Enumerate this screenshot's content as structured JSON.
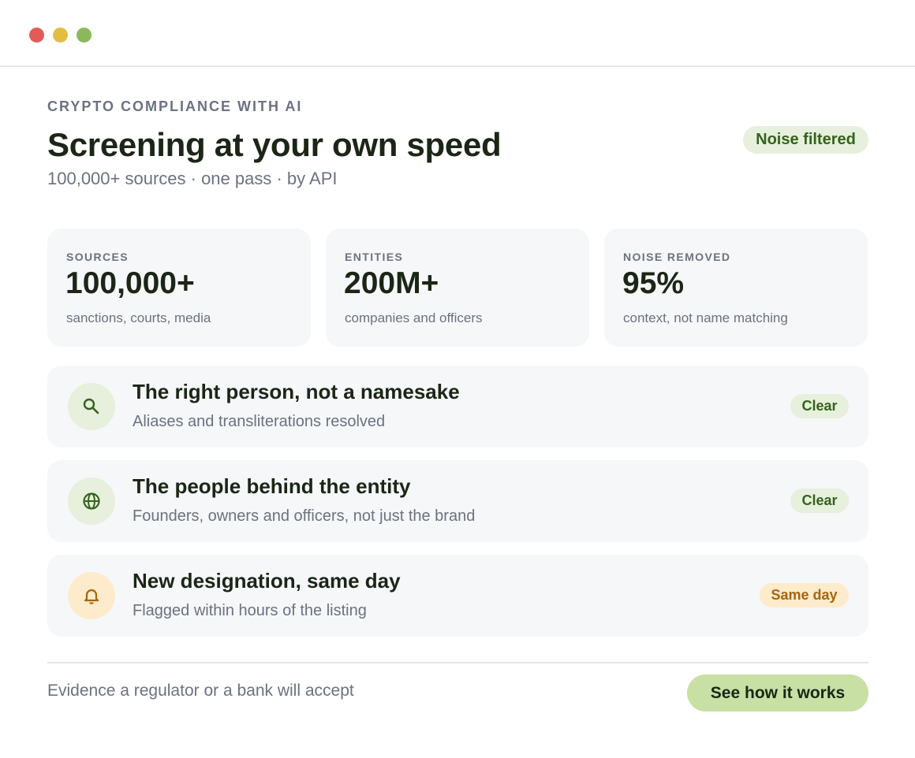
{
  "window": {
    "controls": [
      "close",
      "minimize",
      "maximize"
    ]
  },
  "hero": {
    "eyebrow": "CRYPTO COMPLIANCE WITH AI",
    "title": "Screening at your own speed",
    "subtitle": "100,000+ sources · one pass · by API",
    "status_pill": "Noise filtered"
  },
  "stats": [
    {
      "label": "SOURCES",
      "value": "100,000+",
      "description": "sanctions, courts, media"
    },
    {
      "label": "ENTITIES",
      "value": "200M+",
      "description": "companies and officers"
    },
    {
      "label": "NOISE REMOVED",
      "value": "95%",
      "description": "context, not name matching"
    }
  ],
  "features": [
    {
      "icon": "search-icon",
      "title": "The right person, not a namesake",
      "description": "Aliases and transliterations resolved",
      "badge": "Clear",
      "badge_color": "#35631c"
    },
    {
      "icon": "globe-icon",
      "title": "The people behind the entity",
      "description": "Founders, owners and officers, not just the brand",
      "badge": "Clear",
      "badge_color": "#35631c"
    },
    {
      "icon": "bell-icon",
      "title": "New designation, same day",
      "description": "Flagged within hours of the listing",
      "badge": "Same day",
      "badge_color": "#a66512"
    }
  ],
  "footer": {
    "text": "Evidence a regulator or a bank will accept",
    "cta_label": "See how it works"
  },
  "colors": {
    "accent_green": "#35631c",
    "accent_green_bg": "#e6f0dc",
    "cta_bg": "#c8e0a4",
    "amber": "#a66512",
    "amber_bg": "#fdebcb",
    "card_bg": "#f6f7f9"
  }
}
